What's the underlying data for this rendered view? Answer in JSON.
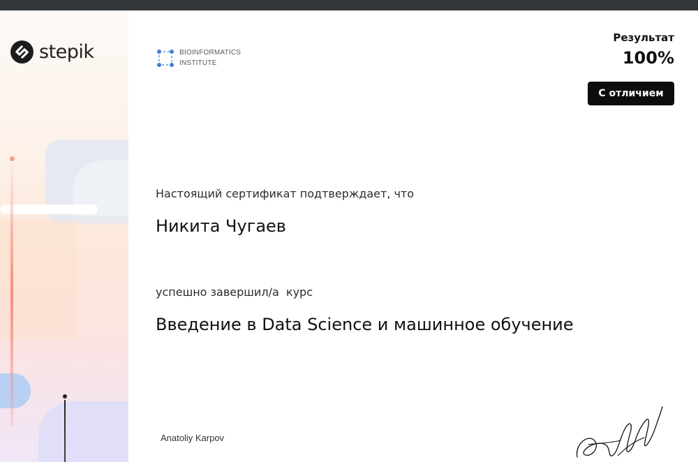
{
  "platform": {
    "logo_text": "stepik",
    "icon": "stepik-logo-icon"
  },
  "institute": {
    "line1": "BIOINFORMATICS",
    "line2": "INSTITUTE",
    "icon": "bioinformatics-institute-logo-icon"
  },
  "result": {
    "label": "Результат",
    "value": "100%",
    "badge": "С отличием"
  },
  "certificate": {
    "intro": "Настоящий сертификат подтверждает, что",
    "recipient": "Никита Чугаев",
    "completed_text": "успешно завершил/а  курс",
    "course_title": "Введение в Data Science и машинное обучение"
  },
  "signer": {
    "name": "Anatoliy Karpov",
    "signature_icon": "handwritten-signature"
  },
  "colors": {
    "topbar": "#333639",
    "badge_bg": "#0d0d0d",
    "accent_blue": "#3f7fd9"
  }
}
